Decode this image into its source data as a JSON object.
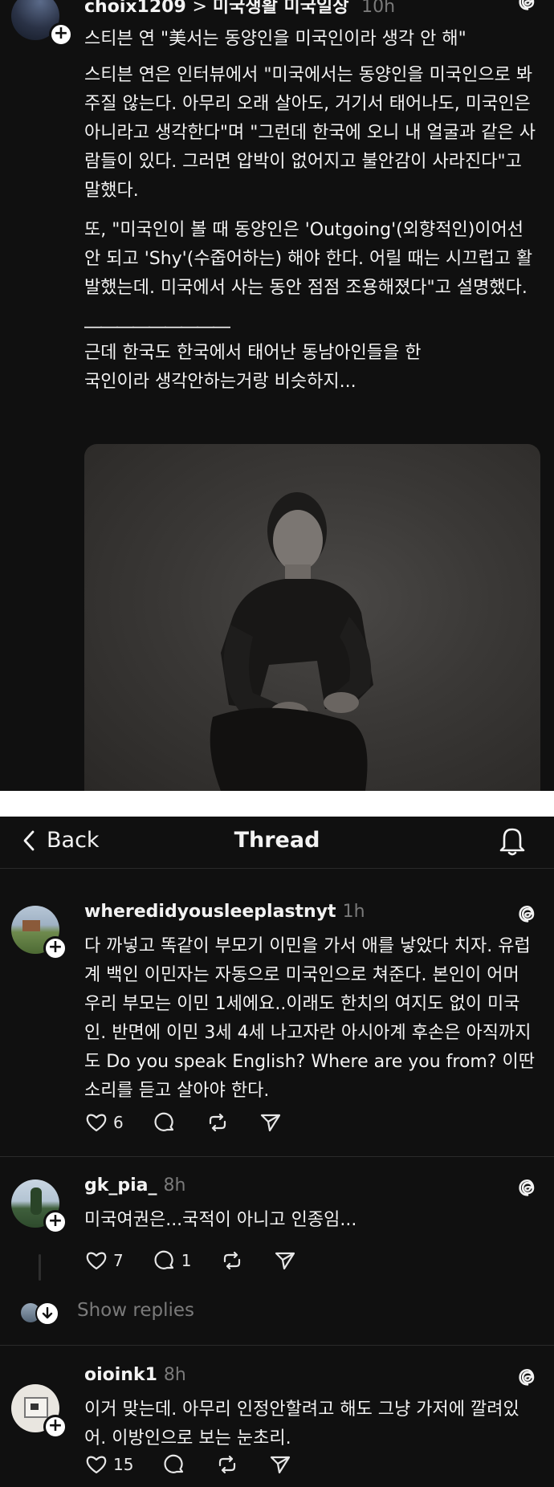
{
  "top_post": {
    "username": "choix1209",
    "community": "미국생활 미국일상",
    "time": "10h",
    "title": "스티븐 연 \"美서는 동양인을 미국인이라 생각 안 해\"",
    "paragraphs": [
      "스티븐 연은 인터뷰에서 \"미국에서는 동양인을 미국인으로 봐주질 않는다. 아무리 오래 살아도, 거기서 태어나도, 미국인은 아니라고 생각한다\"며 \"그런데 한국에 오니 내 얼굴과 같은 사람들이 있다. 그러면 압박이 없어지고 불안감이 사라진다\"고 말했다.",
      "또, \"미국인이 볼 때 동양인은 'Outgoing'(외향적인)이어선 안 되고 'Shy'(수줍어하는) 해야 한다. 어릴 때는 시끄럽고 활발했는데. 미국에서 사는 동안 점점 조용해졌다\"고 설명했다.",
      "―――――――――",
      "근데 한국도 한국에서 태어난 동남아인들을 한국인이라 생각안하는거랑 비슷하지..."
    ]
  },
  "nav": {
    "back_label": "Back",
    "title": "Thread"
  },
  "replies": [
    {
      "username": "wheredidyousleeplastnyt",
      "time": "1h",
      "text": "다 까넣고 똑같이 부모기 이민을 가서 애를 낳았다 치자. 유럽계 백인 이민자는 자동으로 미국인으로 쳐준다. 본인이 어머 우리 부모는 이민 1세에요..이래도 한치의 여지도 없이 미국인. 반면에 이민 3세 4세 나고자란 아시아계 후손은 아직까지도 Do you speak English? Where are you from? 이딴소리를 듣고 살아야 한다.",
      "likes": "6",
      "comments": ""
    },
    {
      "username": "gk_pia_",
      "time": "8h",
      "text": "미국여권은...국적이 아니고 인종임...",
      "likes": "7",
      "comments": "1"
    },
    {
      "username": "oioink1",
      "time": "8h",
      "text": "이거 맞는데. 아무리 인정안할려고 해도 그냥 가저에 깔려있어. 이방인으로 보는 눈초리.",
      "likes": "15",
      "comments": ""
    }
  ],
  "show_replies_label": "Show replies",
  "icons": [
    "threads-icon",
    "plus-icon",
    "back-chevron-icon",
    "bell-icon",
    "heart-icon",
    "comment-icon",
    "repost-icon",
    "share-icon"
  ]
}
